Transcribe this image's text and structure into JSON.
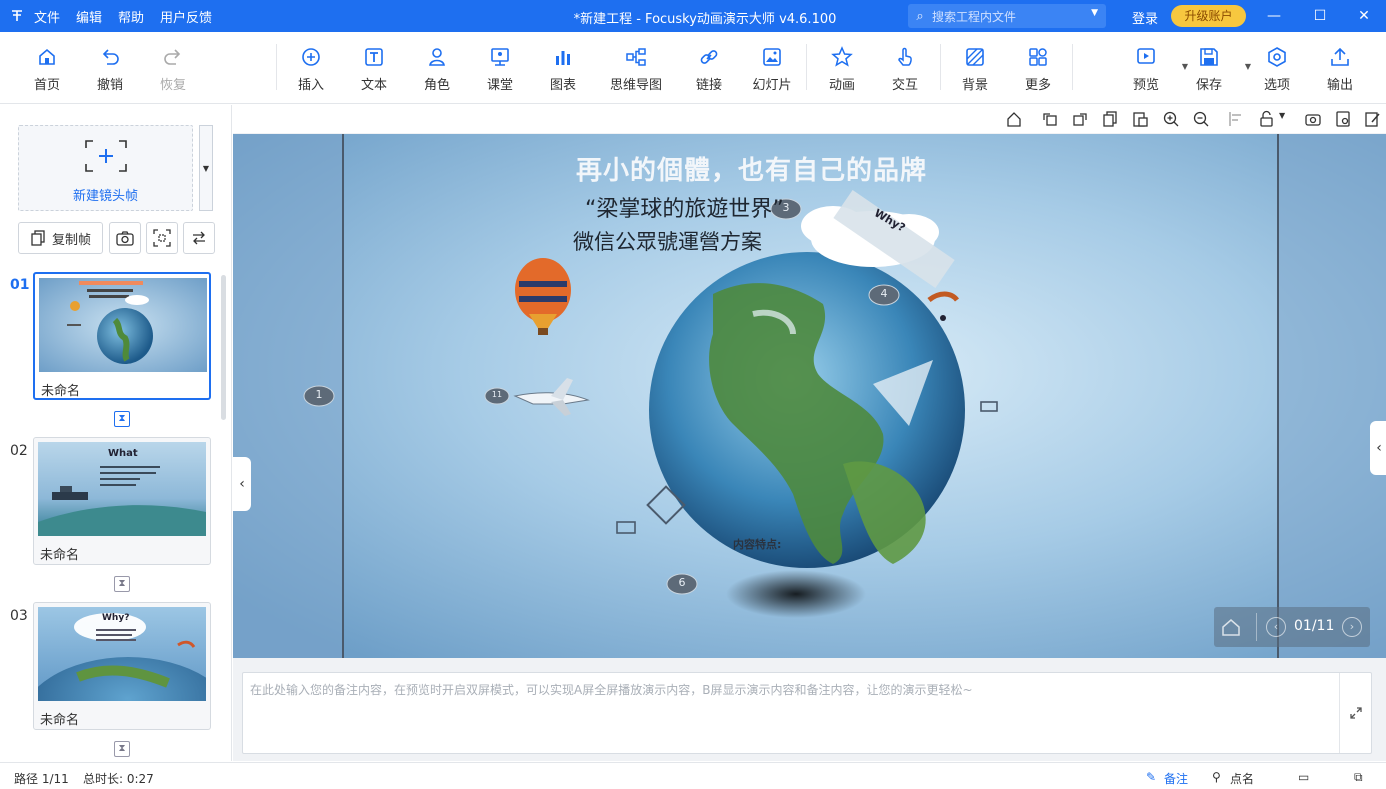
{
  "titlebar": {
    "menu": [
      "文件",
      "编辑",
      "帮助",
      "用户反馈"
    ],
    "title": "*新建工程 - Focusky动画演示大师  v4.6.100",
    "search_placeholder": "搜索工程内文件",
    "login": "登录",
    "upgrade": "升级账户"
  },
  "toolbar": {
    "home": "首页",
    "undo": "撤销",
    "redo": "恢复",
    "insert": "插入",
    "text": "文本",
    "role": "角色",
    "classroom": "课堂",
    "chart": "图表",
    "mindmap": "思维导图",
    "link": "链接",
    "slideshow": "幻灯片",
    "animation": "动画",
    "interact": "交互",
    "background": "背景",
    "more": "更多",
    "preview": "预览",
    "save": "保存",
    "options": "选项",
    "export": "输出"
  },
  "leftpanel": {
    "new_frame": "新建镜头帧",
    "copy_frame": "复制帧",
    "slides": [
      {
        "num": "01",
        "name": "未命名"
      },
      {
        "num": "02",
        "name": "未命名"
      },
      {
        "num": "03",
        "name": "未命名"
      }
    ],
    "thumb2_title": "What",
    "thumb3_title": "Why?"
  },
  "stage": {
    "headline": "再小的個體，也有自己的品牌",
    "subtitle1": "“梁掌球的旅遊世界”",
    "subtitle2": "微信公眾號運營方案",
    "cloud_label": "Why?",
    "content_label": "内容特点:",
    "markers": [
      "1",
      "3",
      "4",
      "6",
      "11"
    ],
    "page_indicator": "01/11"
  },
  "notes": {
    "placeholder": "在此处输入您的备注内容，在预览时开启双屏模式，可以实现A屏全屏播放演示内容，B屏显示演示内容和备注内容，让您的演示更轻松~"
  },
  "statusbar": {
    "path": "路径 1/11",
    "duration": "总时长: 0:27",
    "notes": "备注",
    "rollcall": "点名"
  },
  "colors": {
    "accent": "#1e6ff0",
    "upgrade": "#f7c73f",
    "stage_bg": "#8db6d8"
  }
}
